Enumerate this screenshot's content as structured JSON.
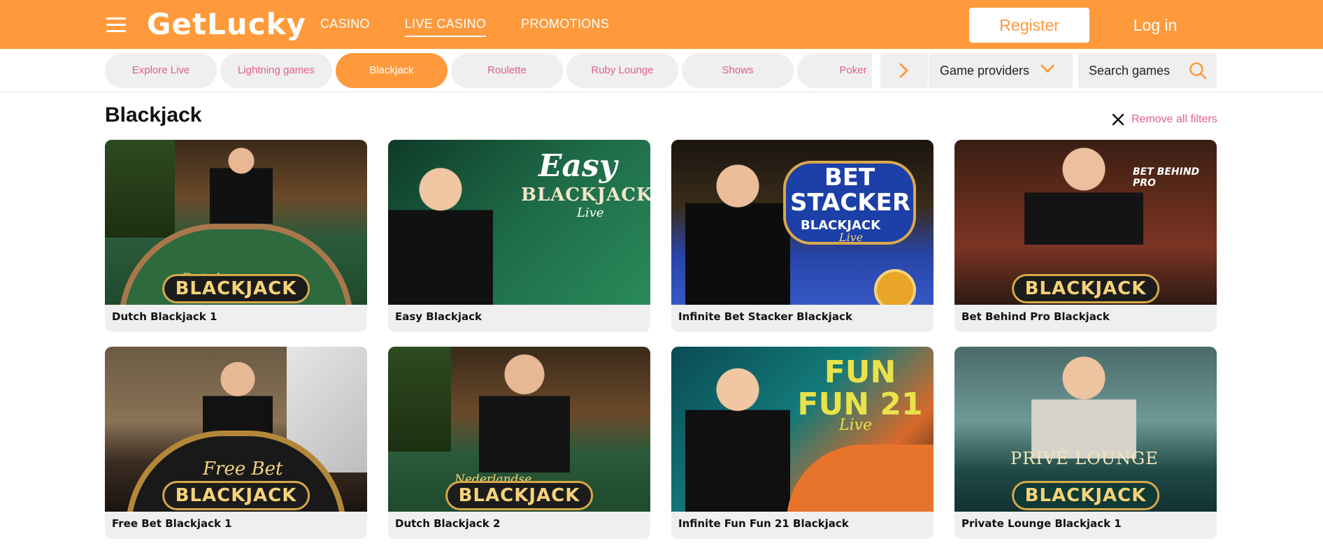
{
  "header": {
    "logo": "GetLucky",
    "nav": [
      {
        "label": "CASINO",
        "active": false
      },
      {
        "label": "LIVE CASINO",
        "active": true
      },
      {
        "label": "PROMOTIONS",
        "active": false
      }
    ],
    "register_label": "Register",
    "login_label": "Log in"
  },
  "categories": [
    {
      "label": "Explore Live",
      "active": false
    },
    {
      "label": "Lightning games",
      "active": false
    },
    {
      "label": "Blackjack",
      "active": true
    },
    {
      "label": "Roulette",
      "active": false
    },
    {
      "label": "Ruby Lounge",
      "active": false
    },
    {
      "label": "Shows",
      "active": false
    },
    {
      "label": "Poker",
      "active": false
    }
  ],
  "filters": {
    "providers_label": "Game providers",
    "search_placeholder": "Search games"
  },
  "section": {
    "title": "Blackjack",
    "remove_filters_label": "Remove all filters"
  },
  "games": [
    {
      "name": "Dutch Blackjack 1",
      "art_top": "Dutch",
      "art_main": "BLACKJACK"
    },
    {
      "name": "Easy Blackjack",
      "art_top": "Easy",
      "art_main": "BLACKJACK",
      "art_sub": "Live"
    },
    {
      "name": "Infinite Bet Stacker Blackjack",
      "art_top": "BET STACKER",
      "art_main": "BLACKJACK",
      "art_sub": "Live"
    },
    {
      "name": "Bet Behind Pro Blackjack",
      "art_top": "BET BEHIND PRO",
      "art_main": "BLACKJACK"
    },
    {
      "name": "Free Bet Blackjack 1",
      "art_top": "Free Bet",
      "art_main": "BLACKJACK"
    },
    {
      "name": "Dutch Blackjack 2",
      "art_top": "Nederlandse",
      "art_main": "BLACKJACK"
    },
    {
      "name": "Infinite Fun Fun 21 Blackjack",
      "art_top": "FUN FUN 21",
      "art_main": "",
      "art_sub": "Live"
    },
    {
      "name": "Private Lounge Blackjack 1",
      "art_top": "PRIVÉ LOUNGE",
      "art_main": "BLACKJACK"
    }
  ],
  "colors": {
    "brand_orange": "#ff9a3c",
    "accent_pink": "#e05f86",
    "tile_bg": "#efefef"
  }
}
